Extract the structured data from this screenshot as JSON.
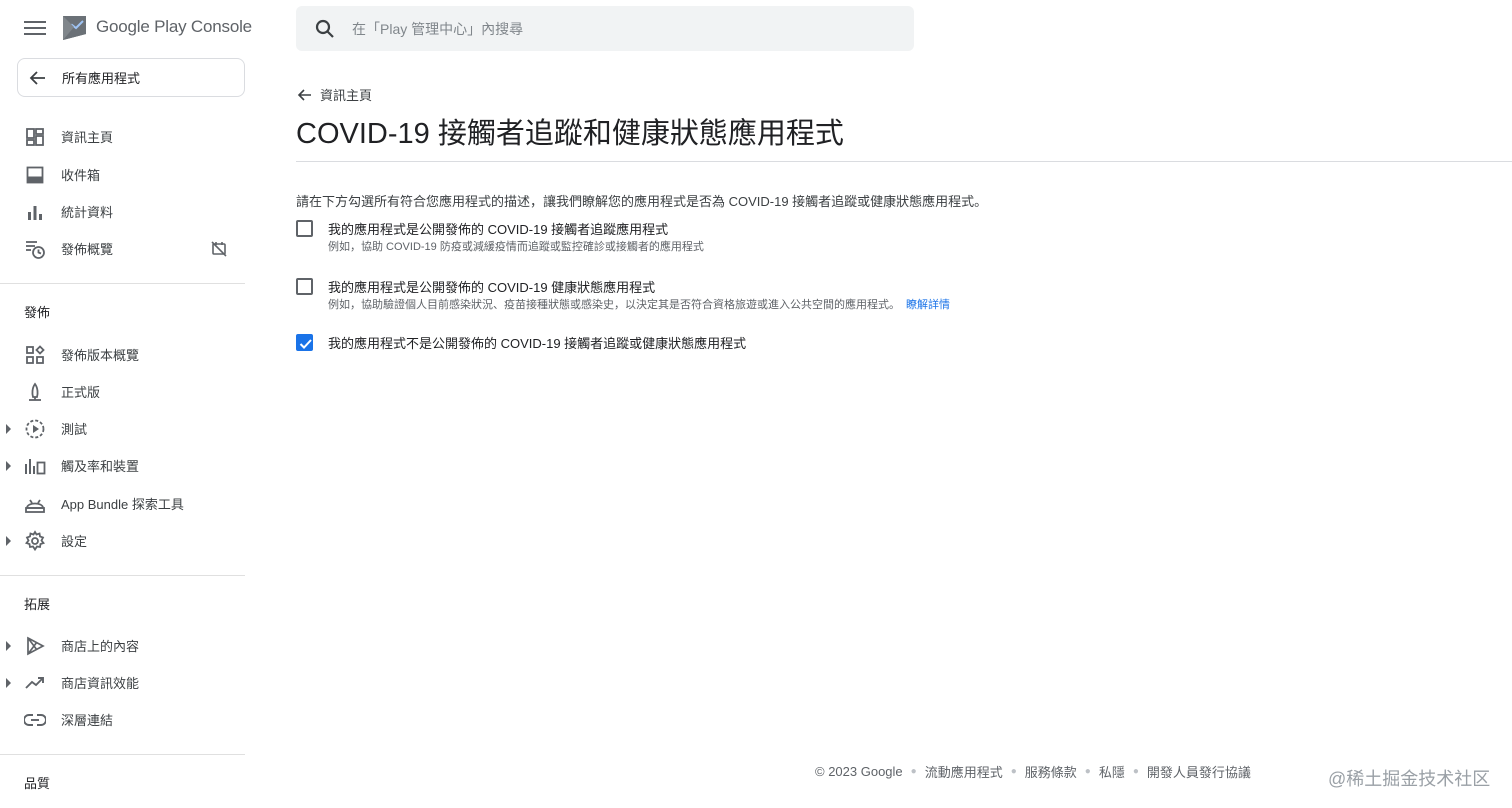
{
  "brand": {
    "name": "Google Play Console"
  },
  "sidebar": {
    "all_apps": "所有應用程式",
    "top_items": [
      {
        "label": "資訊主頁",
        "icon": "dashboard-icon"
      },
      {
        "label": "收件箱",
        "icon": "inbox-icon"
      },
      {
        "label": "統計資料",
        "icon": "bar-chart-icon"
      },
      {
        "label": "發佈概覽",
        "icon": "publishing-overview-icon"
      }
    ],
    "section_release": "發佈",
    "release_items": [
      {
        "label": "發佈版本概覽",
        "icon": "releases-overview-icon"
      },
      {
        "label": "正式版",
        "icon": "production-icon"
      },
      {
        "label": "測試",
        "icon": "testing-icon"
      },
      {
        "label": "觸及率和裝置",
        "icon": "reach-devices-icon"
      },
      {
        "label": "App Bundle 探索工具",
        "icon": "android-icon"
      },
      {
        "label": "設定",
        "icon": "gear-icon"
      }
    ],
    "section_grow": "拓展",
    "grow_items": [
      {
        "label": "商店上的內容",
        "icon": "play-store-icon"
      },
      {
        "label": "商店資訊效能",
        "icon": "trending-up-icon"
      },
      {
        "label": "深層連結",
        "icon": "link-icon"
      }
    ],
    "section_quality": "品質"
  },
  "search": {
    "placeholder": "在「Play 管理中心」內搜尋"
  },
  "main": {
    "back_link": "資訊主頁",
    "title": "COVID-19 接觸者追蹤和健康狀態應用程式",
    "intro": "請在下方勾選所有符合您應用程式的描述，讓我們瞭解您的應用程式是否為 COVID-19 接觸者追蹤或健康狀態應用程式。",
    "options": [
      {
        "label": "我的應用程式是公開發佈的 COVID-19 接觸者追蹤應用程式",
        "sub": "例如，協助 COVID-19 防疫或減緩疫情而追蹤或監控確診或接觸者的應用程式",
        "checked": false
      },
      {
        "label": "我的應用程式是公開發佈的 COVID-19 健康狀態應用程式",
        "sub": "例如，協助驗證個人目前感染狀況、疫苗接種狀態或感染史，以決定其是否符合資格旅遊或進入公共空間的應用程式。",
        "link": "瞭解詳情",
        "checked": false
      },
      {
        "label": "我的應用程式不是公開發佈的 COVID-19 接觸者追蹤或健康狀態應用程式",
        "checked": true
      }
    ]
  },
  "footer": {
    "copyright": "© 2023 Google",
    "links": [
      "流動應用程式",
      "服務條款",
      "私隱",
      "開發人員發行協議"
    ]
  },
  "watermark": "@稀土掘金技术社区",
  "colors": {
    "accent": "#1a73e8",
    "text": "#202124",
    "muted": "#5f6368"
  }
}
